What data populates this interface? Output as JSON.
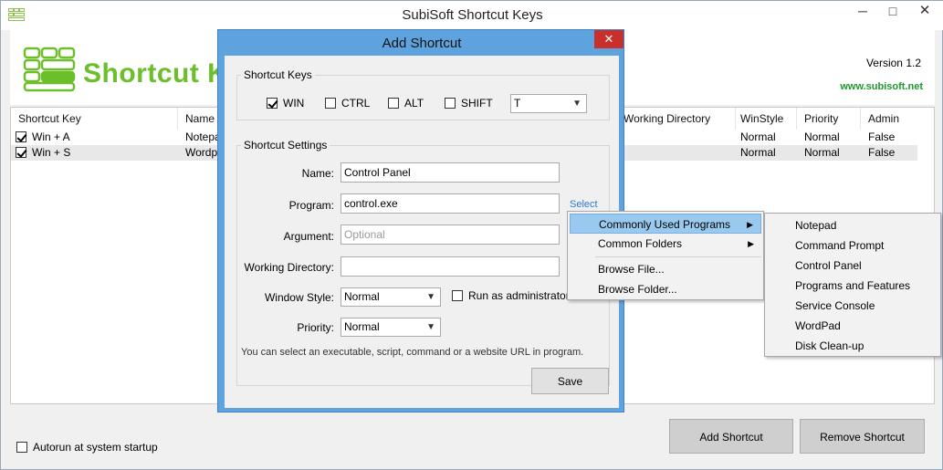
{
  "window": {
    "title": "SubiSoft Shortcut Keys",
    "minimize": "─",
    "maximize": "□",
    "close": "✕"
  },
  "header": {
    "brand": "Shortcut Keys",
    "version": "Version 1.2",
    "site": "www.subisoft.net",
    "brand_color": "#6cbf2b",
    "site_color": "#1f9a2e"
  },
  "table": {
    "columns": [
      "Shortcut Key",
      "Name",
      "Working Directory",
      "WinStyle",
      "Priority",
      "Admin"
    ],
    "rows": [
      {
        "checked": true,
        "key": "Win + A",
        "name": "Notepa",
        "winstyle": "Normal",
        "priority": "Normal",
        "admin": "False"
      },
      {
        "checked": true,
        "key": "Win + S",
        "name": "Wordpa",
        "winstyle": "Normal",
        "priority": "Normal",
        "admin": "False"
      }
    ]
  },
  "footer": {
    "autorun": "Autorun at system startup",
    "add": "Add Shortcut",
    "remove": "Remove Shortcut"
  },
  "dialog": {
    "title": "Add Shortcut",
    "close": "✕",
    "keys_group": "Shortcut Keys",
    "modifiers": {
      "win": "WIN",
      "ctrl": "CTRL",
      "alt": "ALT",
      "shift": "SHIFT"
    },
    "modifier_state": {
      "win": true,
      "ctrl": false,
      "alt": false,
      "shift": false
    },
    "key_value": "T",
    "settings_group": "Shortcut Settings",
    "name_label": "Name:",
    "name_value": "Control Panel",
    "program_label": "Program:",
    "program_value": "control.exe",
    "select_link": "Select",
    "argument_label": "Argument:",
    "argument_placeholder": "Optional",
    "workdir_label": "Working Directory:",
    "workdir_value": "",
    "winstyle_label": "Window Style:",
    "winstyle_value": "Normal",
    "runadmin_label": "Run as administrator",
    "priority_label": "Priority:",
    "priority_value": "Normal",
    "hint": "You can select an executable, script, command or a website URL in program.",
    "save": "Save"
  },
  "context_menu": {
    "items": [
      "Commonly Used Programs",
      "Common Folders",
      "Browse File...",
      "Browse Folder..."
    ],
    "submenu_arrow": "▶"
  },
  "submenu": {
    "items": [
      "Notepad",
      "Command Prompt",
      "Control Panel",
      "Programs and Features",
      "Service Console",
      "WordPad",
      "Disk Clean-up"
    ]
  }
}
